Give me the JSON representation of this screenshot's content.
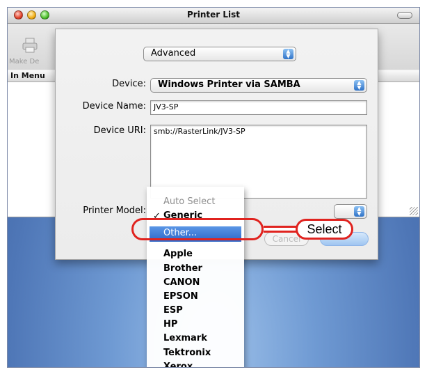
{
  "window": {
    "title": "Printer List"
  },
  "toolbar": {
    "make_default_label": "Make De"
  },
  "list": {
    "column_header": "In Menu"
  },
  "sheet": {
    "mode_popup": "Advanced",
    "device_label": "Device:",
    "device_value": "Windows Printer via SAMBA",
    "device_name_label": "Device Name:",
    "device_name_value": "JV3-SP",
    "device_uri_label": "Device URI:",
    "device_uri_value": "smb://RasterLink/JV3-SP",
    "printer_model_label": "Printer Model:",
    "cancel_label": "Cancel"
  },
  "model_menu": {
    "auto_select": "Auto Select",
    "generic": "Generic",
    "checked_mark": "✓",
    "other": "Other...",
    "vendors": [
      "Apple",
      "Brother",
      "CANON",
      "EPSON",
      "ESP",
      "HP",
      "Lexmark",
      "Tektronix",
      "Xerox"
    ]
  },
  "annotation": {
    "callout_text": "Select",
    "color": "#e0231f"
  },
  "colors": {
    "highlight": "#3b78d8",
    "desktop": "#4f77b7",
    "popup_accent": "#2f73c8"
  }
}
